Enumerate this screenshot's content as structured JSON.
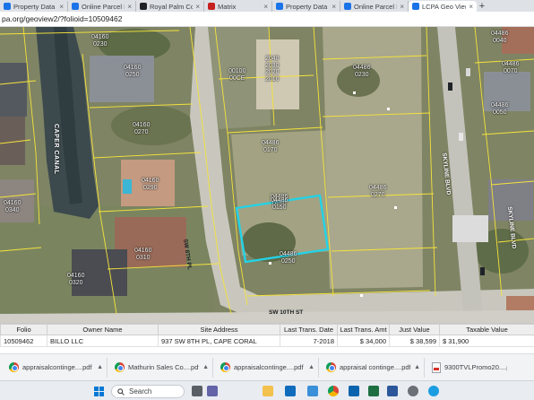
{
  "browser": {
    "tabs": [
      {
        "label": "Property Data Sea",
        "color": "#1a73e8"
      },
      {
        "label": "Online Parcel Inqu",
        "color": "#1a73e8"
      },
      {
        "label": "Royal Palm Coast",
        "color": "#202124"
      },
      {
        "label": "Matrix",
        "color": "#c5221f"
      },
      {
        "label": "Property Data Sea",
        "color": "#1a73e8"
      },
      {
        "label": "Online Parcel Inqu",
        "color": "#1a73e8"
      },
      {
        "label": "LCPA Geo View",
        "color": "#1a73e8",
        "active": true
      }
    ],
    "close_glyph": "×",
    "new_tab_glyph": "+",
    "url": "pa.org/geoview2/?folioid=10509462"
  },
  "map": {
    "labels": {
      "canal": "CAPER CANAL",
      "sw_8th_pl": "SW 8TH PL",
      "sw_10th_st": "SW 10TH ST",
      "skyline_blvd_1": "SKYLINE BLVD",
      "skyline_blvd_2": "SKYLINE BLVD"
    },
    "parcels": [
      {
        "id": "p1",
        "text": "04160\n0230"
      },
      {
        "id": "p2",
        "text": "04160\n0250"
      },
      {
        "id": "p3",
        "text": "04160\n0270"
      },
      {
        "id": "p4",
        "text": "04160\n0290"
      },
      {
        "id": "p5",
        "text": "04160\n0310"
      },
      {
        "id": "p6",
        "text": "04160\n0320"
      },
      {
        "id": "p7",
        "text": "04160\n0340"
      },
      {
        "id": "p8",
        "text": "00100\n00CE"
      },
      {
        "id": "p9",
        "text": "2040\n2030\n2020\n2010"
      },
      {
        "id": "p10",
        "text": "04486\n0230"
      },
      {
        "id": "p11",
        "text": "04486\n0050"
      },
      {
        "id": "p12",
        "text": "04486\n0070"
      },
      {
        "id": "p13",
        "text": "04486\n0270"
      },
      {
        "id": "p14",
        "text": "04486\n0150"
      },
      {
        "id": "p15",
        "text": "04486\n0170"
      },
      {
        "id": "p16",
        "text": "04486\n0150"
      },
      {
        "id": "p17",
        "text": "04486\n0250"
      },
      {
        "id": "p18",
        "text": "04486\n0040"
      }
    ]
  },
  "parcel_table": {
    "headers": [
      "Folio",
      "Owner Name",
      "Site Address",
      "Last Trans. Date",
      "Last Trans. Amt",
      "Just Value",
      "Taxable Value"
    ],
    "row": [
      "10509462",
      "BILLO LLC",
      "937 SW 8TH PL, CAPE CORAL",
      "7-2018",
      "$ 34,000",
      "$ 38,599",
      "$ 31,900"
    ]
  },
  "downloads": [
    {
      "name": "appraisalcontinge....pdf",
      "type": "chrome"
    },
    {
      "name": "Mathurin Sales Co....pdf",
      "type": "chrome"
    },
    {
      "name": "appraisalcontinge....pdf",
      "type": "chrome"
    },
    {
      "name": "appraisal continge....pdf",
      "type": "chrome"
    },
    {
      "name": "9300TVLPromo20....pdf",
      "type": "pdf"
    }
  ],
  "taskbar": {
    "search_label": "Search",
    "icons": [
      {
        "name": "file-explorer-icon",
        "color": "#f2c14e"
      },
      {
        "name": "mail-icon",
        "color": "#0f6cbd"
      },
      {
        "name": "chrome-taskbar-icon",
        "color": "#34a853"
      },
      {
        "name": "edge-icon",
        "color": "#1b9de2"
      },
      {
        "name": "excel-icon",
        "color": "#1d6f42"
      },
      {
        "name": "word-icon",
        "color": "#2b579a"
      },
      {
        "name": "settings-icon",
        "color": "#6b6f76"
      },
      {
        "name": "store-icon",
        "color": "#5558af"
      }
    ]
  },
  "accent_colors": {
    "selection": "#22d3e6",
    "parcel_lines": "#f5e33b"
  }
}
